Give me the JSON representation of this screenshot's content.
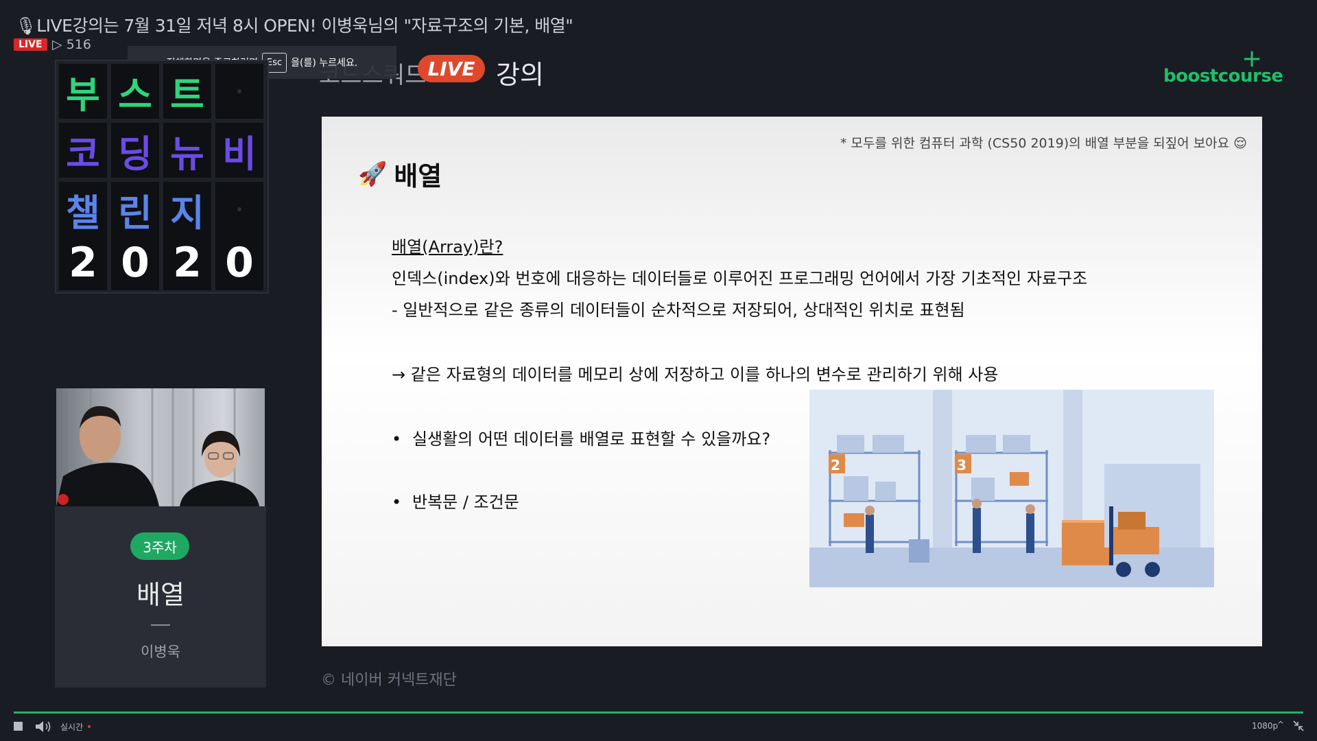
{
  "stream": {
    "title": "🎙LIVE강의는 7월 31일 저녁 8시 OPEN! 이병욱님의 \"자료구조의 기본, 배열\"",
    "live_badge": "LIVE",
    "viewers": "▷ 516"
  },
  "fullscreen_tip": {
    "before": "전체화면을 종료하려면",
    "key": "Esc",
    "after": "을(를) 누르세요."
  },
  "banner": {
    "text": "코드스쿼드 ",
    "live": "LIVE",
    "lecture": "강의"
  },
  "logo": {
    "plus": "+",
    "text": "boostcourse"
  },
  "board": {
    "rows": [
      [
        "부",
        "스",
        "트",
        ""
      ],
      [
        "코",
        "딩",
        "뉴",
        "비"
      ],
      [
        "챌",
        "린",
        "지",
        ""
      ],
      [
        "2",
        "0",
        "2",
        "0"
      ]
    ]
  },
  "episode": {
    "week": "3주차",
    "title": "배열",
    "presenter": "이병욱"
  },
  "slide": {
    "note": "* 모두를 위한 컴퓨터 과학 (CS50 2019)의 배열 부분을 되짚어 보아요 😌",
    "rocket": "🚀",
    "heading": "배열",
    "def_title": "배열(Array)란?",
    "def_line1": "인덱스(index)와 번호에 대응하는 데이터들로 이루어진 프로그래밍 언어에서 가장 기초적인 자료구조",
    "def_line2": "- 일반적으로 같은 종류의 데이터들이 순차적으로 저장되어, 상대적인 위치로 표현됨",
    "arrow_line": "→ 같은 자료형의 데이터를 메모리 상에 저장하고 이를 하나의 변수로 관리하기 위해 사용",
    "bullet_mark": "•",
    "bullet1": "실생활의 어떤 데이터를 배열로 표현할 수 있을까요?",
    "bullet2": "반복문 / 조건문",
    "shelf_numbers": [
      "2",
      "3"
    ]
  },
  "copyright": "© 네이버 커넥트재단",
  "player": {
    "realtime": "실시간",
    "quality": "1080p",
    "quality_chevron": "^"
  },
  "colors": {
    "accent_green": "#1fbf6a",
    "live_red": "#d9262b",
    "banner_live": "#e0482c",
    "tile_green": "#2fd57b",
    "tile_purple": "#6b4be6",
    "tile_blue": "#5a84ea"
  }
}
